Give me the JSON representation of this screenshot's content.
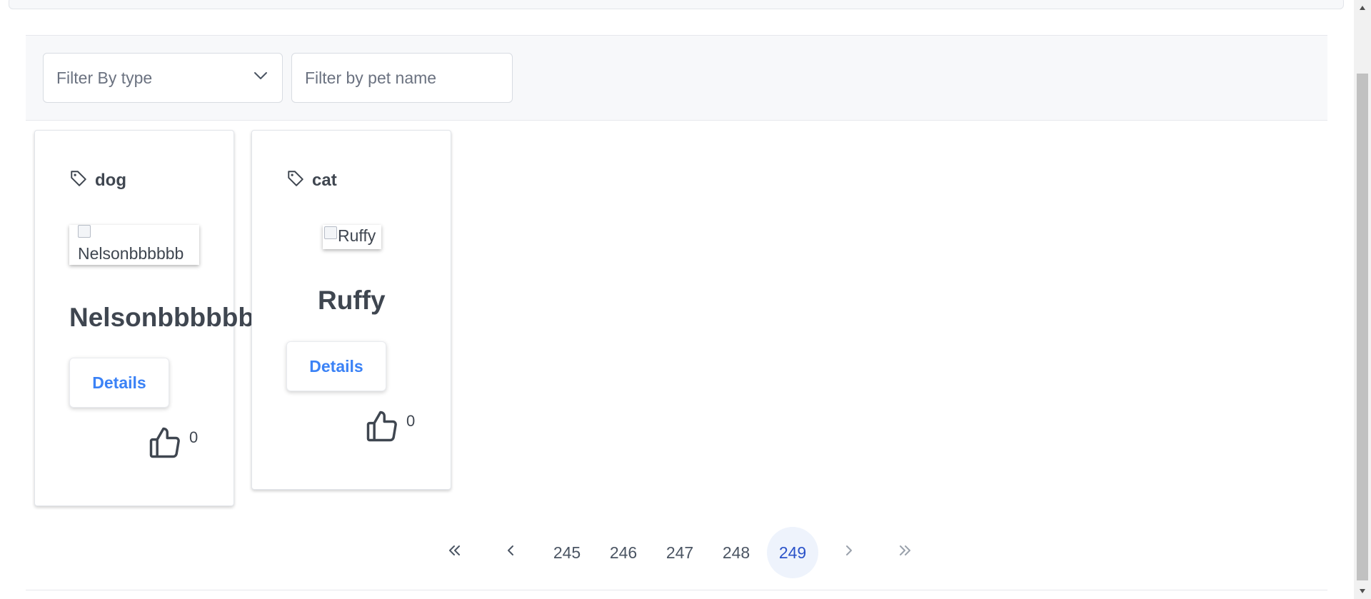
{
  "filters": {
    "type_placeholder": "Filter By type",
    "name_placeholder": "Filter by pet name"
  },
  "pets": [
    {
      "type": "dog",
      "image_alt": "Nelsonbbbbbb",
      "name": "Nelsonbbbbbb",
      "details_label": "Details",
      "likes": "0"
    },
    {
      "type": "cat",
      "image_alt": "Ruffy",
      "name": "Ruffy",
      "details_label": "Details",
      "likes": "0"
    }
  ],
  "pagination": {
    "pages": [
      "245",
      "246",
      "247",
      "248",
      "249"
    ],
    "current": "249"
  },
  "icons": {
    "tag": "tag-icon",
    "like": "thumbs-up-icon",
    "dropdown": "chevron-down-icon",
    "first": "double-chevron-left-icon",
    "prev": "chevron-left-icon",
    "next": "chevron-right-icon",
    "last": "double-chevron-right-icon"
  },
  "colors": {
    "accent": "#3b82f6",
    "active_page_bg": "#eef3fc",
    "active_page_text": "#2c53c9"
  }
}
